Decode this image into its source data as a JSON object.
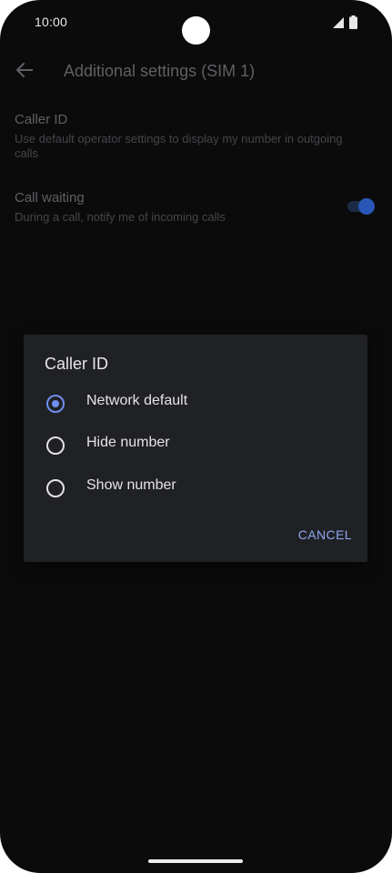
{
  "status_bar": {
    "time": "10:00",
    "icons": [
      "signal-icon",
      "battery-icon"
    ]
  },
  "app_bar": {
    "back_icon": "arrow-left-icon",
    "title": "Additional settings (SIM 1)"
  },
  "settings": {
    "caller_id": {
      "title": "Caller ID",
      "summary": "Use default operator settings to display my number in outgoing calls"
    },
    "call_waiting": {
      "title": "Call waiting",
      "summary": "During a call, notify me of incoming calls",
      "enabled": true
    }
  },
  "dialog": {
    "title": "Caller ID",
    "options": [
      {
        "label": "Network default",
        "selected": true
      },
      {
        "label": "Hide number",
        "selected": false
      },
      {
        "label": "Show number",
        "selected": false
      }
    ],
    "cancel_label": "CANCEL"
  },
  "colors": {
    "background": "#0b0b0c",
    "dialog_background": "#202124",
    "accent": "#6f8ff0",
    "dimmed_text": "#5f6064",
    "toggle_on": "#2a56b8"
  }
}
